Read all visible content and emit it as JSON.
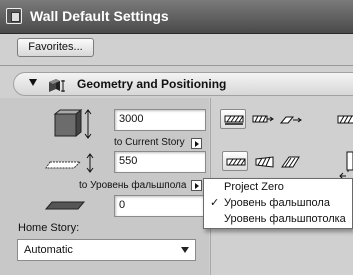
{
  "window": {
    "title": "Wall Default Settings"
  },
  "toolbar": {
    "favorites_label": "Favorites..."
  },
  "section": {
    "title": "Geometry and Positioning"
  },
  "geometry": {
    "height_value": "3000",
    "top_link_label": "to Current Story",
    "offset_value": "550",
    "bottom_link_label": "to Уровень фальшпола",
    "base_value": "0"
  },
  "home_story": {
    "label": "Home Story:",
    "selected": "Automatic"
  },
  "popup_menu": {
    "items": [
      {
        "label": "Project Zero",
        "checked": false
      },
      {
        "label": "Уровень фальшпола",
        "checked": true,
        "check_mark": "✓"
      },
      {
        "label": "Уровень фальшпотолка",
        "checked": false
      }
    ]
  }
}
